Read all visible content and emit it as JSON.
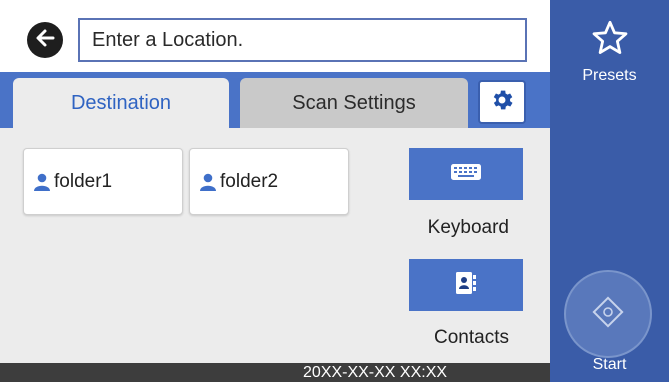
{
  "location": {
    "placeholder": "Enter a Location."
  },
  "tabs": {
    "destination": "Destination",
    "scan_settings": "Scan Settings"
  },
  "folders": [
    {
      "label": "folder1"
    },
    {
      "label": "folder2"
    }
  ],
  "side_buttons": {
    "keyboard_label": "Keyboard",
    "contacts_label": "Contacts"
  },
  "status": {
    "datetime": "20XX-XX-XX XX:XX"
  },
  "right_panel": {
    "presets_label": "Presets",
    "start_label": "Start"
  },
  "icons": {
    "back": "back-arrow-icon",
    "gear": "gear-icon",
    "person": "person-icon",
    "keyboard": "keyboard-icon",
    "contacts": "contacts-book-icon",
    "star": "star-icon",
    "start": "start-diamond-icon"
  },
  "colors": {
    "accent": "#4a73c7",
    "panel": "#3a5ca8",
    "status_bar": "#3d3d3d",
    "active_tab_text": "#2f63c2"
  }
}
